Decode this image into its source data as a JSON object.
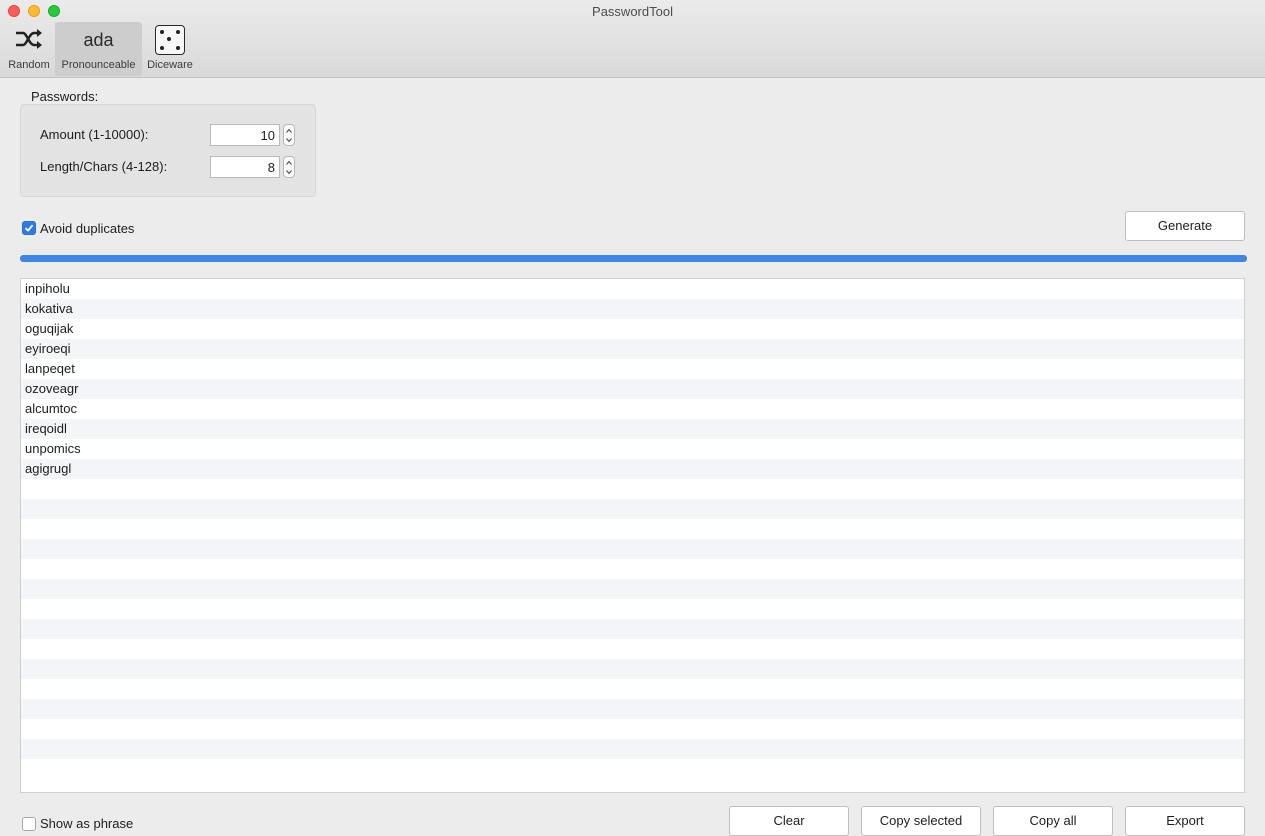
{
  "window": {
    "title": "PasswordTool"
  },
  "toolbar": [
    {
      "label": "Random",
      "icon": "shuffle-icon"
    },
    {
      "label": "Pronounceable",
      "icon": "ada",
      "selected": true
    },
    {
      "label": "Diceware",
      "icon": "dice-icon"
    }
  ],
  "passwords_group": {
    "title": "Passwords:",
    "amount_label": "Amount (1-10000):",
    "amount_value": "10",
    "length_label": "Length/Chars (4-128):",
    "length_value": "8"
  },
  "avoid_duplicates": {
    "label": "Avoid duplicates",
    "checked": true
  },
  "generate_label": "Generate",
  "progress": {
    "percent": 100,
    "color": "#3b86e6"
  },
  "passwords": [
    "inpiholu",
    "kokativa",
    "oguqijak",
    "eyiroeqi",
    "lanpeqet",
    "ozoveagr",
    "alcumtoc",
    "ireqoidl",
    "unpomics",
    "agigrugl"
  ],
  "empty_rows": 15,
  "bottom": {
    "show_hint_label": "Show as phrase",
    "buttons": {
      "clear": "Clear",
      "copy_selected": "Copy selected",
      "copy_all": "Copy all",
      "export": "Export"
    }
  }
}
